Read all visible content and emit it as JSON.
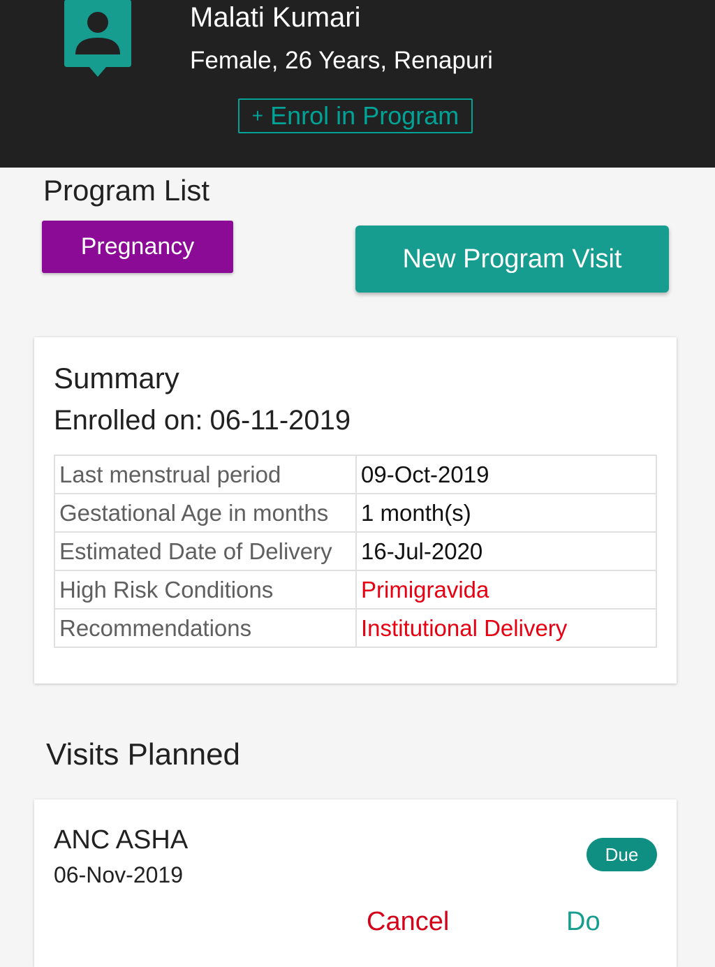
{
  "header": {
    "patient_name": "Malati Kumari",
    "patient_details": "Female, 26 Years, Renapuri",
    "enrol_icon": "plus-icon",
    "enrol_label": "Enrol in Program",
    "avatar_icon": "person-icon"
  },
  "programs": {
    "title": "Program List",
    "items": [
      {
        "label": "Pregnancy"
      }
    ],
    "new_visit_label": "New Program Visit"
  },
  "summary": {
    "title": "Summary",
    "enrolled_label": "Enrolled on:",
    "enrolled_date": "06-11-2019",
    "rows": [
      {
        "label": "Last menstrual period",
        "value": "09-Oct-2019"
      },
      {
        "label": "Gestational Age in months",
        "value": "1 month(s)"
      },
      {
        "label": "Estimated Date of Delivery",
        "value": "16-Jul-2020"
      },
      {
        "label": "High Risk Conditions",
        "value": "Primigravida"
      },
      {
        "label": "Recommendations",
        "value": "Institutional Delivery"
      }
    ]
  },
  "visits": {
    "title": "Visits Planned",
    "items": [
      {
        "name": "ANC ASHA",
        "date": "06-Nov-2019",
        "status": "Due",
        "cancel_label": "Cancel",
        "do_label": "Do"
      }
    ]
  },
  "colors": {
    "header_bg": "#212121",
    "accent_teal": "#169d8f",
    "program_purple": "#8b0a96",
    "alert_red": "#e60012"
  }
}
